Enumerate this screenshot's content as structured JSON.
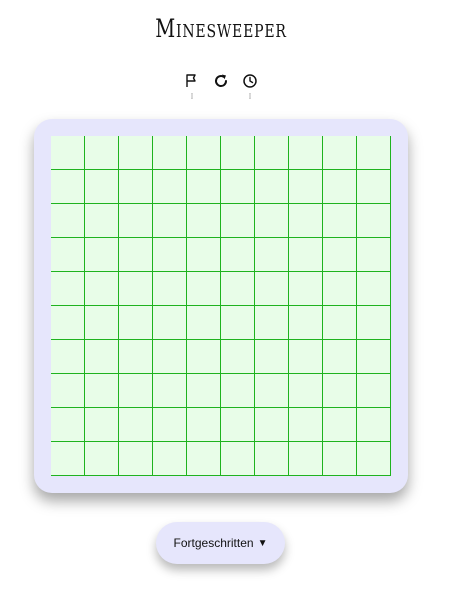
{
  "game": {
    "title": "Minesweeper"
  },
  "toolbar": {
    "flag_icon": "flag-icon",
    "restart_icon": "restart-icon",
    "timer_icon": "clock-icon",
    "flags_counter": "0",
    "timer_counter": "0"
  },
  "board": {
    "rows": 10,
    "columns": 10,
    "cell_color": "#e8fde8",
    "grid_line_color": "#1fb31f",
    "frame_color": "#e6e6fc"
  },
  "difficulty": {
    "selected": "Fortgeschritten",
    "arrow": "▼"
  }
}
